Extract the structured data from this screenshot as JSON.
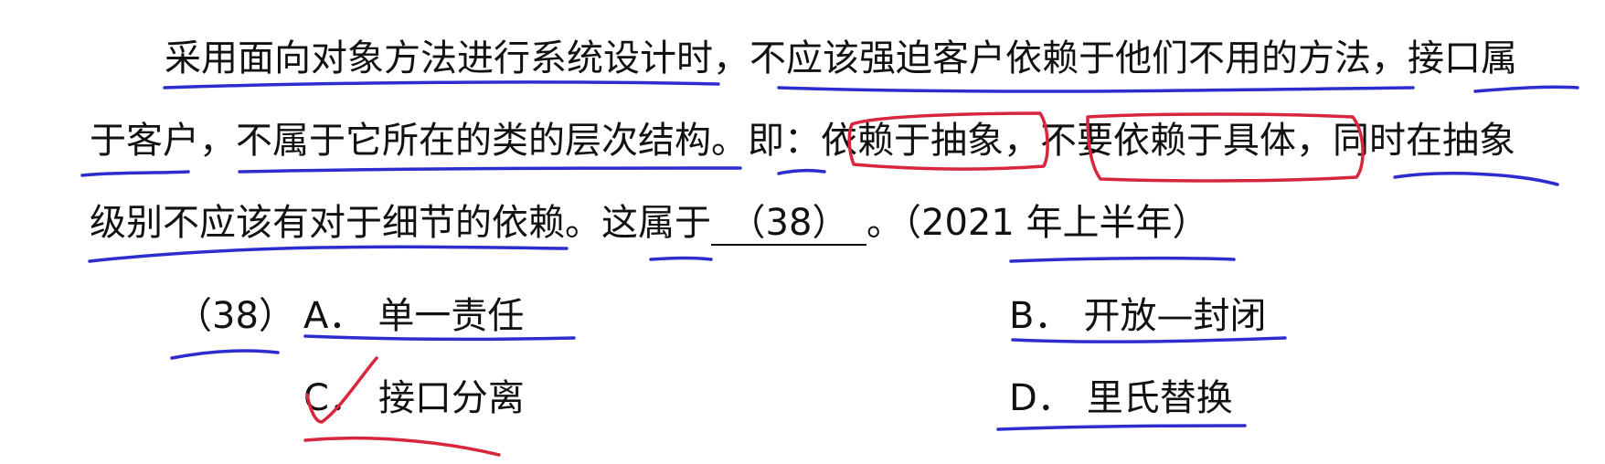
{
  "question": {
    "line1": "采用面向对象方法进行系统设计时，不应该强迫客户依赖于他们不用的方法，接口属",
    "line2": "于客户，不属于它所在的类的层次结构。即：依赖于抽象，不要依赖于具体，同时在抽象",
    "line3_a": "级别不应该有对于细节的依赖。这属于",
    "blank": "（38）",
    "line3_b": "。（2021 年上半年）"
  },
  "options": {
    "number": "（38）",
    "a_letter": "A．",
    "a_text": "单一责任",
    "b_letter": "B．",
    "b_text": "开放—封闭",
    "c_letter": "C．",
    "c_text": "接口分离",
    "d_letter": "D．",
    "d_text": "里氏替换"
  },
  "annotations": {
    "underline_color": "#2c2ccf",
    "highlight_color": "#d7263d",
    "marked_answer": "C"
  }
}
